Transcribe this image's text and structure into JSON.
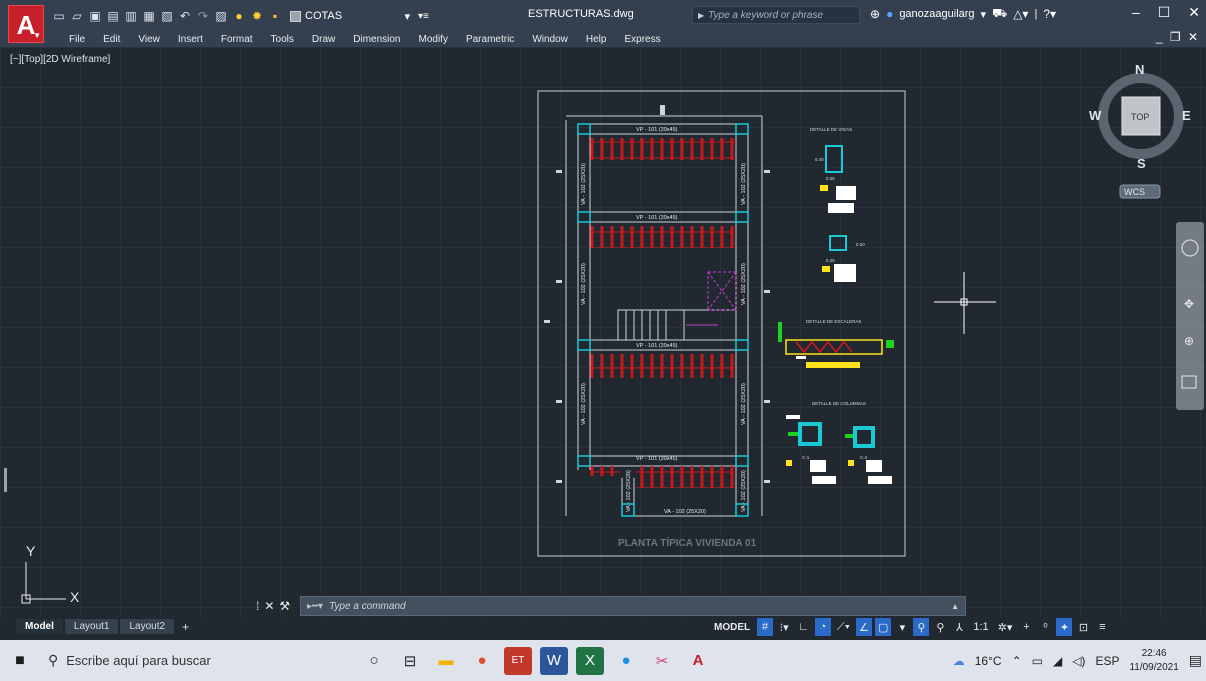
{
  "app": {
    "logo": "A",
    "document_title": "ESTRUCTURAS.dwg",
    "layer_name": "COTAS",
    "search_placeholder": "Type a keyword or phrase",
    "user": "ganozaaguilarg"
  },
  "menus": [
    "File",
    "Edit",
    "View",
    "Insert",
    "Format",
    "Tools",
    "Draw",
    "Dimension",
    "Modify",
    "Parametric",
    "Window",
    "Help",
    "Express"
  ],
  "viewport": {
    "label": "[−][Top][2D Wireframe]",
    "viewcube": {
      "north": "N",
      "south": "S",
      "east": "E",
      "west": "W",
      "face": "TOP",
      "ucs": "WCS"
    },
    "ucs_axis": {
      "x": "X",
      "y": "Y"
    }
  },
  "drawing": {
    "beam_labels": [
      "VP - 101 (30x45)",
      "VP - 101 (30x45)",
      "VP - 101 (30x45)",
      "VP - 101 (30x45)"
    ],
    "side_beam_label": "VA - 102 (25X20)",
    "bottom_beam_label": "VA - 102 (25X20)",
    "plan_title": "PLANTA TÍPICA     VIVIENDA 01",
    "detail_titles": [
      "DETALLE DE VIGAS",
      "DETALLE DE ESCALERAS",
      "DETALLE DE COLUMNAS"
    ],
    "dim_labels": [
      "0.40",
      "0.25",
      "0.20",
      "0.25"
    ],
    "column_tags": [
      "C-1",
      "C-2"
    ]
  },
  "command": {
    "placeholder": "Type a command",
    "prefix": "▸━▾"
  },
  "layout_tabs": [
    "Model",
    "Layout1",
    "Layout2"
  ],
  "status": {
    "model": "MODEL",
    "scale": "1:1"
  },
  "taskbar": {
    "search_text": "Escribe aquí para buscar",
    "weather": "16°C",
    "language": "ESP",
    "time": "22:46",
    "date": "11/09/2021"
  },
  "colors": {
    "accent": "#2a6ac8",
    "canvas": "#212830",
    "brand": "#c8202a"
  }
}
